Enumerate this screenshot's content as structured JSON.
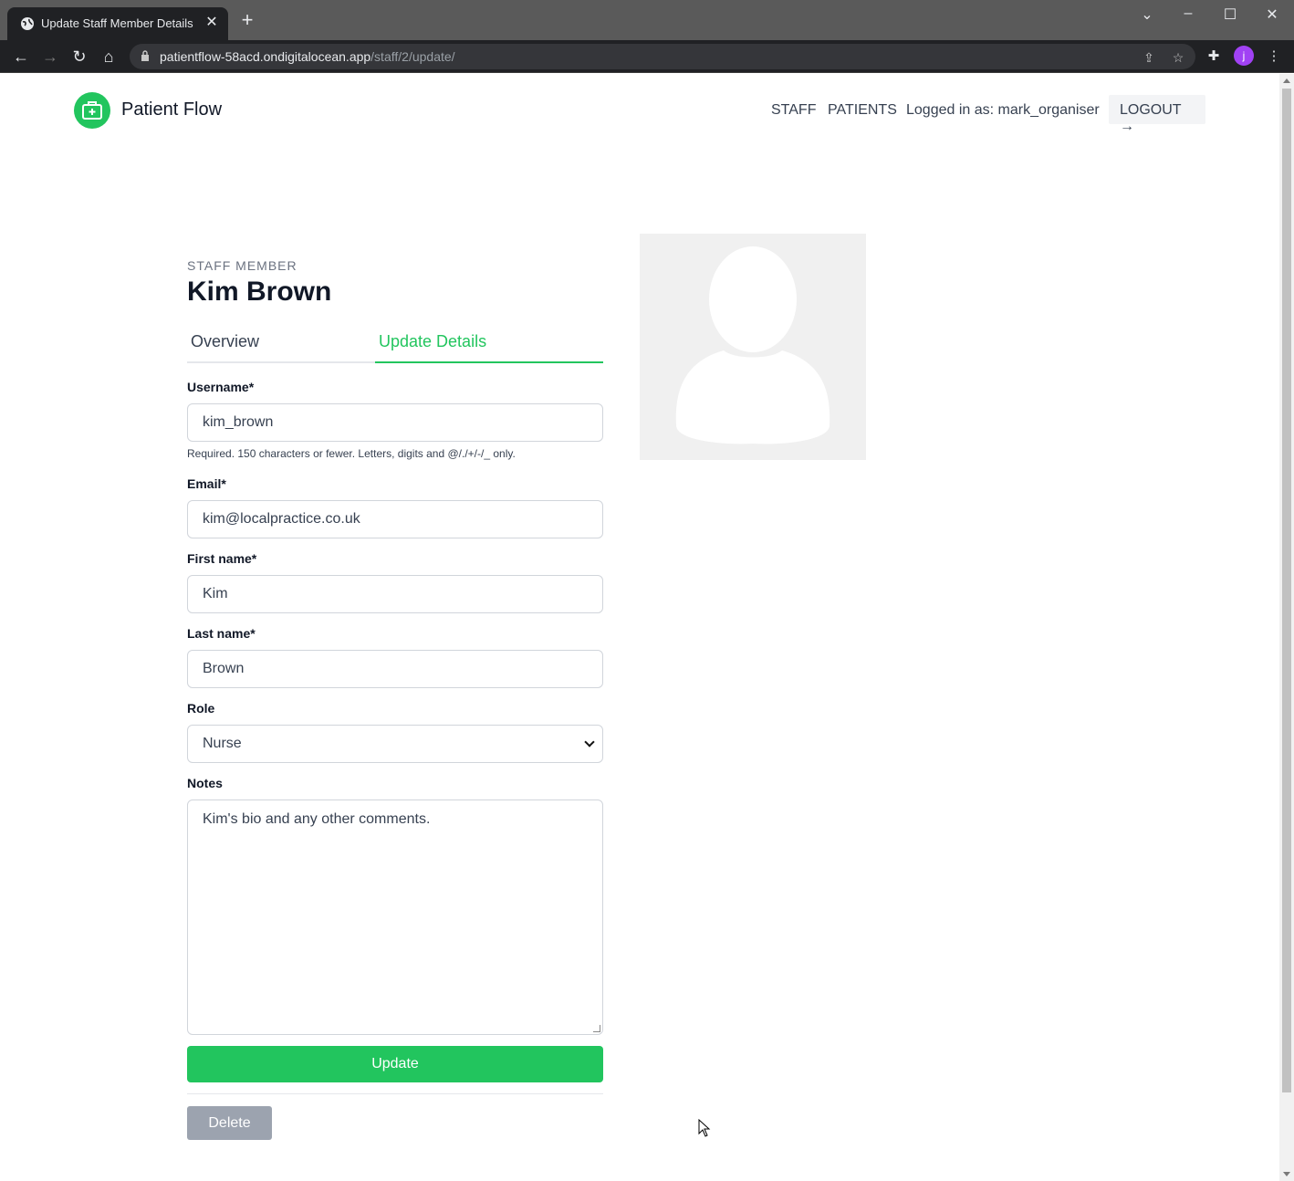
{
  "browser": {
    "tab_title": "Update Staff Member Details",
    "url_host": "patientflow-58acd.ondigitalocean.app",
    "url_path": "/staff/2/update/",
    "profile_initial": "j"
  },
  "header": {
    "brand": "Patient Flow",
    "nav": [
      "STAFF",
      "PATIENTS"
    ],
    "logged_in": "Logged in as: mark_organiser",
    "logout_label": "LOGOUT"
  },
  "staff": {
    "eyebrow": "STAFF MEMBER",
    "name": "Kim Brown"
  },
  "tabs": [
    "Overview",
    "Update Details"
  ],
  "form": {
    "username_label": "Username*",
    "username_value": "kim_brown",
    "username_help": "Required. 150 characters or fewer. Letters, digits and @/./+/-/_ only.",
    "email_label": "Email*",
    "email_value": "kim@localpractice.co.uk",
    "first_name_label": "First name*",
    "first_name_value": "Kim",
    "last_name_label": "Last name*",
    "last_name_value": "Brown",
    "role_label": "Role",
    "role_value": "Nurse",
    "notes_label": "Notes",
    "notes_value": "Kim's bio and any other comments.",
    "update_label": "Update",
    "delete_label": "Delete"
  },
  "colors": {
    "accent": "#22c55e",
    "delete": "#9ca3af"
  }
}
